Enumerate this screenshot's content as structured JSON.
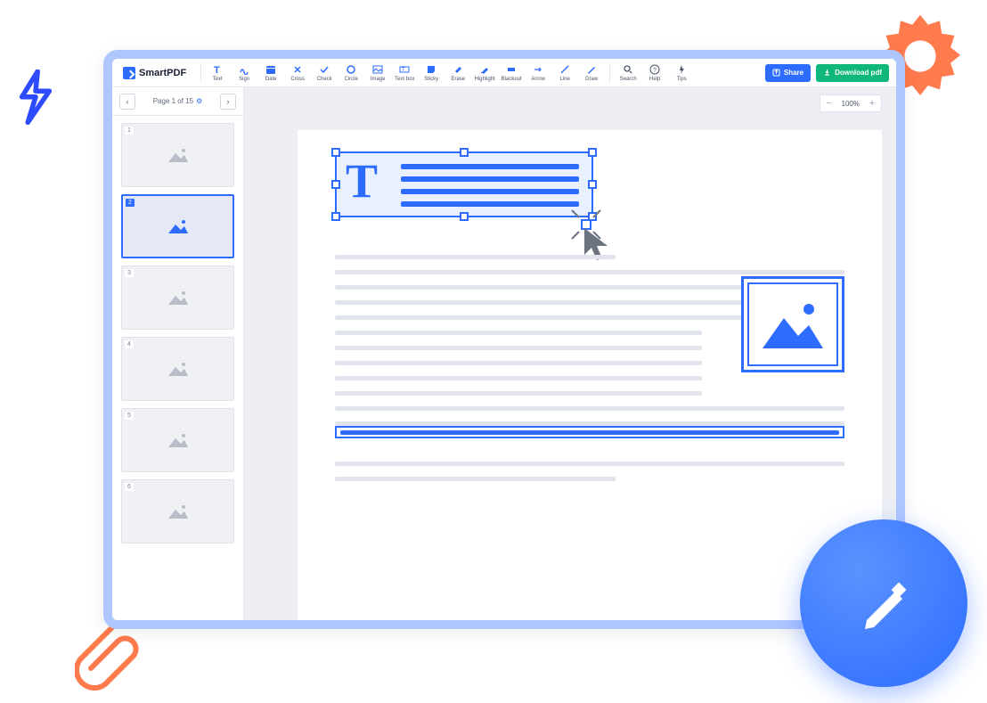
{
  "app": {
    "name": "SmartPDF"
  },
  "toolbar": {
    "text": "Text",
    "sign": "Sign",
    "date": "Date",
    "cross": "Cross",
    "check": "Check",
    "circle": "Circle",
    "image": "Image",
    "textbox": "Text box",
    "sticky": "Sticky",
    "erase": "Erase",
    "highlight": "Highlight",
    "blackout": "Blackout",
    "arrow": "Arrow",
    "line": "Line",
    "draw": "Draw",
    "search": "Search",
    "help": "Help",
    "tips": "Tips"
  },
  "actions": {
    "share": "Share",
    "download": "Download pdf"
  },
  "pager": {
    "label": "Page 1 of 15"
  },
  "zoom": {
    "value": "100%"
  },
  "thumbs": {
    "count": 6,
    "active": 2,
    "labels": [
      "1",
      "2",
      "3",
      "4",
      "5",
      "6"
    ]
  },
  "colors": {
    "primary": "#2d6cff",
    "success": "#0fb87a",
    "orange": "#ff7a4d"
  }
}
